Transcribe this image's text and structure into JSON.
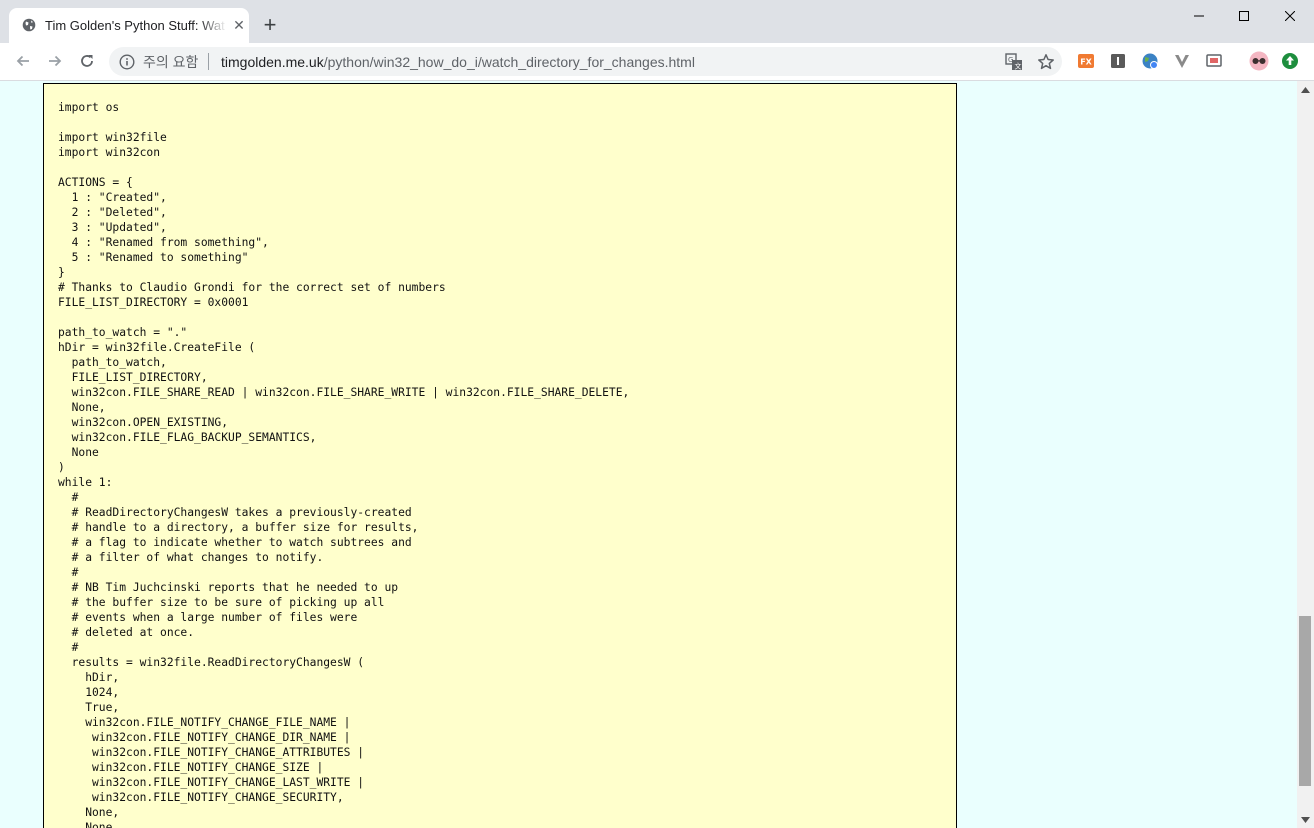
{
  "tab": {
    "title": "Tim Golden's Python Stuff: Watch a Directory for Changes",
    "close_glyph": "✕"
  },
  "new_tab_glyph": "+",
  "omnibox": {
    "security_label": "주의 요함",
    "url_host": "timgolden.me.uk",
    "url_path": "/python/win32_how_do_i/watch_directory_for_changes.html"
  },
  "code_lines": [
    "import os",
    "",
    "import win32file",
    "import win32con",
    "",
    "ACTIONS = {",
    "  1 : \"Created\",",
    "  2 : \"Deleted\",",
    "  3 : \"Updated\",",
    "  4 : \"Renamed from something\",",
    "  5 : \"Renamed to something\"",
    "}",
    "# Thanks to Claudio Grondi for the correct set of numbers",
    "FILE_LIST_DIRECTORY = 0x0001",
    "",
    "path_to_watch = \".\"",
    "hDir = win32file.CreateFile (",
    "  path_to_watch,",
    "  FILE_LIST_DIRECTORY,",
    "  win32con.FILE_SHARE_READ | win32con.FILE_SHARE_WRITE | win32con.FILE_SHARE_DELETE,",
    "  None,",
    "  win32con.OPEN_EXISTING,",
    "  win32con.FILE_FLAG_BACKUP_SEMANTICS,",
    "  None",
    ")",
    "while 1:",
    "  #",
    "  # ReadDirectoryChangesW takes a previously-created",
    "  # handle to a directory, a buffer size for results,",
    "  # a flag to indicate whether to watch subtrees and",
    "  # a filter of what changes to notify.",
    "  #",
    "  # NB Tim Juchcinski reports that he needed to up",
    "  # the buffer size to be sure of picking up all",
    "  # events when a large number of files were",
    "  # deleted at once.",
    "  #",
    "  results = win32file.ReadDirectoryChangesW (",
    "    hDir,",
    "    1024,",
    "    True,",
    "    win32con.FILE_NOTIFY_CHANGE_FILE_NAME |",
    "     win32con.FILE_NOTIFY_CHANGE_DIR_NAME |",
    "     win32con.FILE_NOTIFY_CHANGE_ATTRIBUTES |",
    "     win32con.FILE_NOTIFY_CHANGE_SIZE |",
    "     win32con.FILE_NOTIFY_CHANGE_LAST_WRITE |",
    "     win32con.FILE_NOTIFY_CHANGE_SECURITY,",
    "    None,",
    "    None"
  ],
  "colors": {
    "page_background": "#eafffe",
    "code_background": "#ffffcc",
    "tabstrip": "#dee1e6"
  },
  "icons": {
    "favicon": "globe-icon",
    "info": "info-icon",
    "translate": "translate-icon",
    "bookmark": "star-icon",
    "extensions": [
      "fx-extension-icon",
      "info-extension-icon",
      "globe-extension-icon",
      "vivaldi-extension-icon",
      "cast-extension-icon"
    ],
    "profile": "glasses-avatar-icon",
    "update": "update-arrow-icon"
  }
}
